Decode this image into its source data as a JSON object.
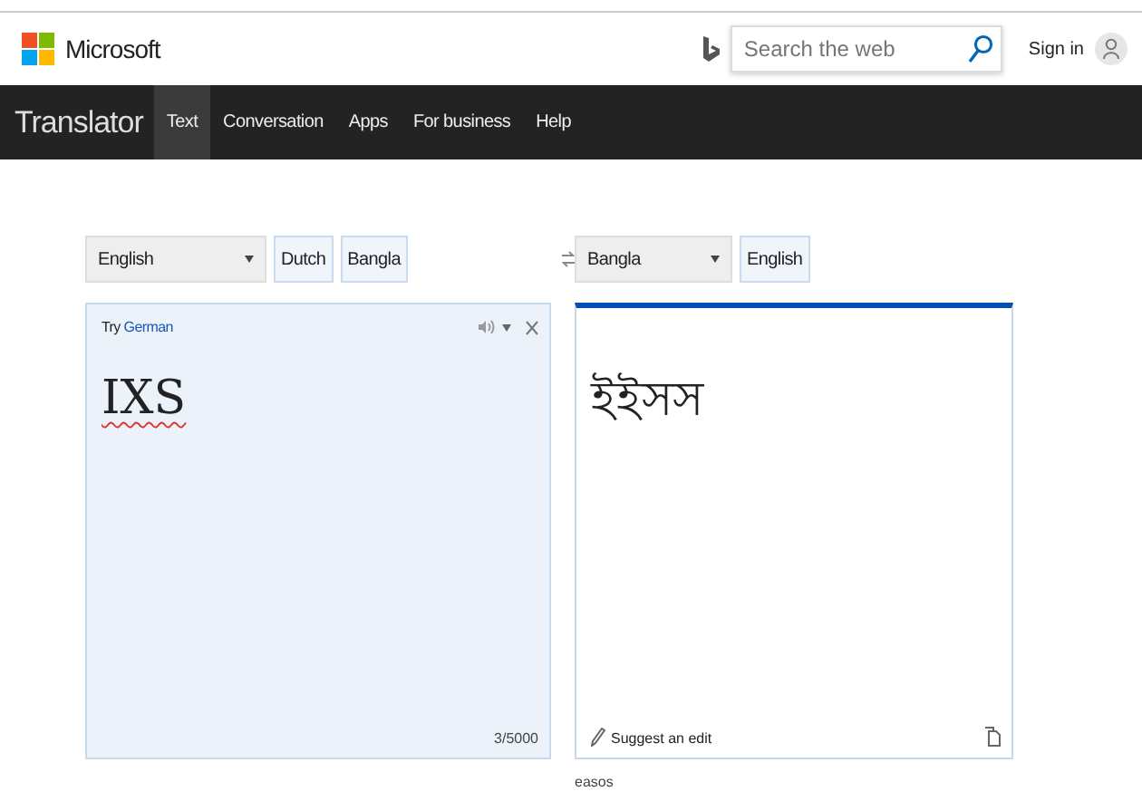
{
  "header": {
    "brand": "Microsoft",
    "search": {
      "placeholder": "Search the web"
    },
    "sign_in": "Sign in"
  },
  "nav": {
    "title": "Translator",
    "items": [
      {
        "label": "Text",
        "selected": true
      },
      {
        "label": "Conversation",
        "selected": false
      },
      {
        "label": "Apps",
        "selected": false
      },
      {
        "label": "For business",
        "selected": false
      },
      {
        "label": "Help",
        "selected": false
      }
    ]
  },
  "source": {
    "language": "English",
    "recent": [
      "Dutch",
      "Bangla"
    ],
    "try_prefix": "Try",
    "try_language": "German",
    "text": "IXS",
    "counter": "3/5000"
  },
  "target": {
    "language": "Bangla",
    "recent": [
      "English"
    ],
    "text": "ইইসস",
    "suggest": "Suggest an edit",
    "transliteration": "easos"
  }
}
